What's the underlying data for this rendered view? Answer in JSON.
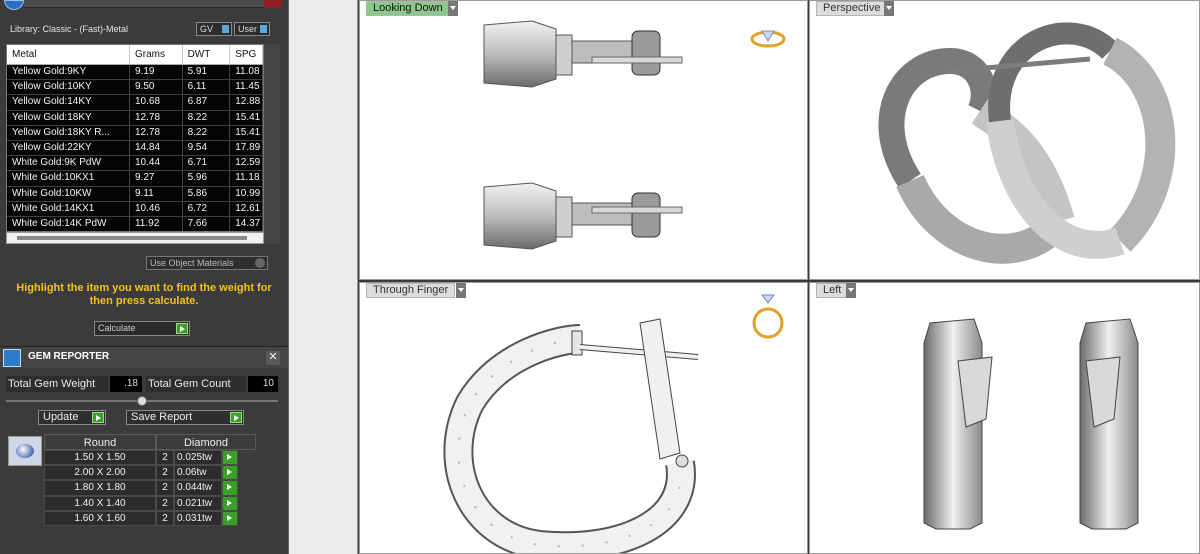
{
  "metal_panel": {
    "library_label": "Library: Classic - (Fast)-Metal",
    "gv_label": "GV",
    "user_label": "User",
    "columns": [
      "Metal",
      "Grams",
      "DWT",
      "SPG"
    ],
    "rows": [
      [
        "Yellow Gold:9KY",
        "9.19",
        "5.91",
        "11.08"
      ],
      [
        "Yellow Gold:10KY",
        "9.50",
        "6.11",
        "11.45"
      ],
      [
        "Yellow Gold:14KY",
        "10.68",
        "6.87",
        "12.88"
      ],
      [
        "Yellow Gold:18KY",
        "12.78",
        "8.22",
        "15.41"
      ],
      [
        "Yellow Gold:18KY R...",
        "12.78",
        "8.22",
        "15.41"
      ],
      [
        "Yellow Gold:22KY",
        "14.84",
        "9.54",
        "17.89"
      ],
      [
        "White Gold:9K PdW",
        "10.44",
        "6.71",
        "12.59"
      ],
      [
        "White Gold:10KX1",
        "9.27",
        "5.96",
        "11.18"
      ],
      [
        "White Gold:10KW",
        "9.11",
        "5.86",
        "10.99"
      ],
      [
        "White Gold:14KX1",
        "10.46",
        "6.72",
        "12.61"
      ],
      [
        "White Gold:14K PdW",
        "11.92",
        "7.66",
        "14.37"
      ]
    ],
    "use_object_materials": "Use Object Materials",
    "hint": "Highlight the item you want to find the weight for then press calculate.",
    "calculate_label": "Calculate"
  },
  "gem_reporter": {
    "title": "GEM REPORTER",
    "close": "✕",
    "total_weight_label": "Total Gem Weight",
    "total_weight_value": ".18",
    "total_count_label": "Total Gem Count",
    "total_count_value": "10",
    "update_label": "Update",
    "save_report_label": "Save Report",
    "col_shape": "Round",
    "col_type": "Diamond",
    "rows": [
      [
        "1.50 X 1.50",
        "2",
        "0.025tw"
      ],
      [
        "2.00 X 2.00",
        "2",
        "0.06tw"
      ],
      [
        "1.80 X 1.80",
        "2",
        "0.044tw"
      ],
      [
        "1.40 X 1.40",
        "2",
        "0.021tw"
      ],
      [
        "1.60 X 1.60",
        "2",
        "0.031tw"
      ]
    ]
  },
  "viewports": {
    "top_left": "Looking Down",
    "top_right": "Perspective",
    "bottom_left": "Through Finger",
    "bottom_right": "Left"
  },
  "icons": [
    "select-arrow-icon",
    "polyline-icon",
    "circle-icon",
    "arc-icon",
    "rectangle-icon",
    "polygon-icon",
    "curve-icon",
    "surface-icon",
    "box-icon",
    "sphere-icon",
    "cylinder-icon",
    "gem-icon",
    "boolean-icon",
    "transform-icon",
    "text-icon",
    "array-icon",
    "checkmark-icon",
    "prong-icon"
  ],
  "colors": {
    "active_tab": "#8cc78c",
    "hint_text": "#f3c21a",
    "go_button": "#3aa02a"
  }
}
